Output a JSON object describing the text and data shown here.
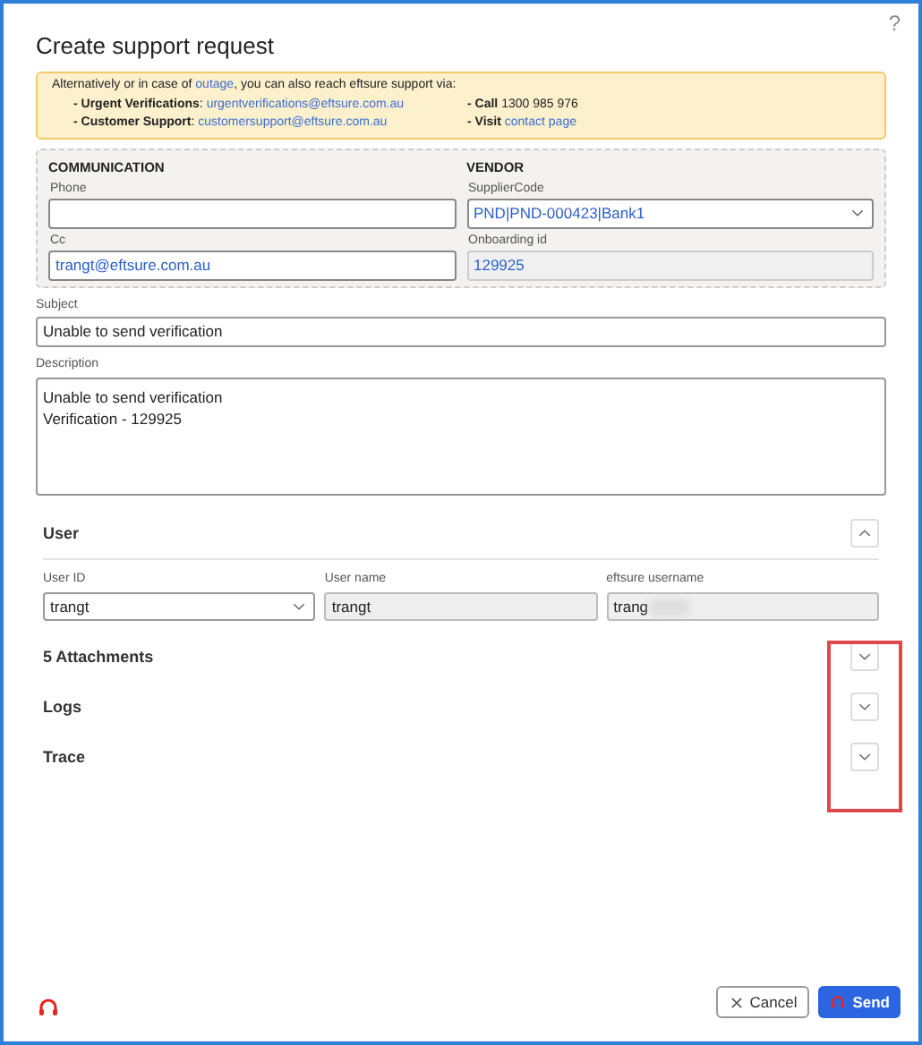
{
  "dialog": {
    "title": "Create support request",
    "help": "?"
  },
  "notice": {
    "intro_before": "Alternatively or in case of ",
    "intro_link": "outage",
    "intro_after": ", you can also reach eftsure support via:",
    "items": [
      {
        "label": "- Urgent Verifications",
        "sep": ":",
        "link": "urgentverifications@eftsure.com.au"
      },
      {
        "label": "- Call",
        "text": "1300 985 976"
      },
      {
        "label": "- Customer Support",
        "sep": ":",
        "link": "customersupport@eftsure.com.au"
      },
      {
        "label": "- Visit",
        "link": "contact page"
      }
    ]
  },
  "communication": {
    "heading": "COMMUNICATION",
    "phone": {
      "label": "Phone"
    },
    "cc": {
      "label": "Cc",
      "value": "trangt@eftsure.com.au"
    }
  },
  "vendor": {
    "heading": "VENDOR",
    "supplier_code": {
      "label": "SupplierCode",
      "value": "PND|PND-000423|Bank1"
    },
    "onboarding_id": {
      "label": "Onboarding id",
      "value": "129925"
    }
  },
  "subject": {
    "label": "Subject",
    "value": "Unable to send verification"
  },
  "description": {
    "label": "Description",
    "value": "Unable to send verification\nVerification - 129925"
  },
  "sections": [
    {
      "title": "User",
      "expanded": true,
      "fields": [
        {
          "kind": "select",
          "label": "User ID",
          "value": "trangt"
        },
        {
          "kind": "readonly",
          "label": "User name",
          "value": "trangt"
        },
        {
          "kind": "blurred",
          "label": "eftsure username",
          "value": "trang"
        }
      ]
    },
    {
      "title": "5 Attachments",
      "expanded": false
    },
    {
      "title": "Logs",
      "expanded": false
    },
    {
      "title": "Trace",
      "expanded": false
    }
  ],
  "buttons": [
    {
      "kind": "cancel",
      "label": "Cancel"
    },
    {
      "kind": "send",
      "label": "Send"
    }
  ]
}
